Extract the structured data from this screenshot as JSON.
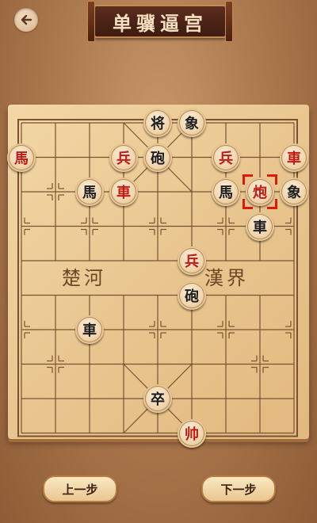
{
  "header": {
    "title": "单骥逼宫"
  },
  "board": {
    "river_left": "楚河",
    "river_right": "漢界",
    "pieces": [
      {
        "char": "将",
        "color": "black",
        "col": 4,
        "row": 0
      },
      {
        "char": "象",
        "color": "black",
        "col": 5,
        "row": 0
      },
      {
        "char": "馬",
        "color": "red",
        "col": 0,
        "row": 1
      },
      {
        "char": "兵",
        "color": "red",
        "col": 3,
        "row": 1
      },
      {
        "char": "砲",
        "color": "black",
        "col": 4,
        "row": 1
      },
      {
        "char": "兵",
        "color": "red",
        "col": 6,
        "row": 1
      },
      {
        "char": "車",
        "color": "red",
        "col": 8,
        "row": 1
      },
      {
        "char": "馬",
        "color": "black",
        "col": 2,
        "row": 2
      },
      {
        "char": "車",
        "color": "red",
        "col": 3,
        "row": 2
      },
      {
        "char": "馬",
        "color": "black",
        "col": 6,
        "row": 2
      },
      {
        "char": "炮",
        "color": "red",
        "col": 7,
        "row": 2,
        "selected": true
      },
      {
        "char": "象",
        "color": "black",
        "col": 8,
        "row": 2
      },
      {
        "char": "車",
        "color": "black",
        "col": 7,
        "row": 3
      },
      {
        "char": "兵",
        "color": "red",
        "col": 5,
        "row": 4
      },
      {
        "char": "砲",
        "color": "black",
        "col": 5,
        "row": 5
      },
      {
        "char": "車",
        "color": "black",
        "col": 2,
        "row": 6
      },
      {
        "char": "卒",
        "color": "black",
        "col": 4,
        "row": 8
      },
      {
        "char": "帅",
        "color": "red",
        "col": 5,
        "row": 9
      }
    ]
  },
  "controls": {
    "prev_label": "上一步",
    "next_label": "下一步"
  },
  "colors": {
    "red_piece": "#c21a12",
    "black_piece": "#1d1d1d",
    "selection": "#e01a0a"
  }
}
